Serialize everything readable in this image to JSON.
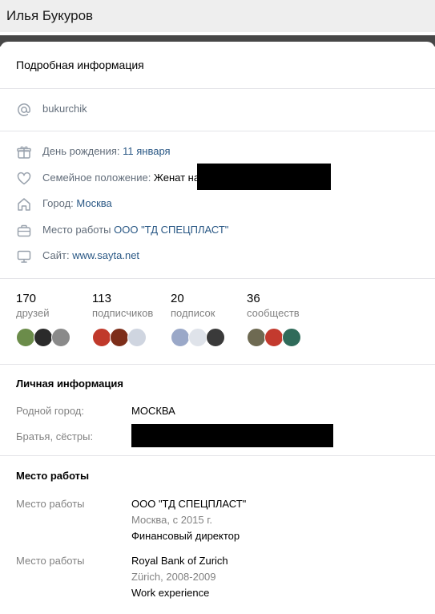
{
  "profile": {
    "name": "Илья Букуров"
  },
  "details": {
    "title": "Подробная информация",
    "username": "bukurchik",
    "birthday": {
      "label": "День рождения: ",
      "value": "11 января"
    },
    "family": {
      "label": "Семейное положение: ",
      "value": "Женат на"
    },
    "city": {
      "label": "Город: ",
      "value": "Москва"
    },
    "work": {
      "label": "Место работы ",
      "value": "ООО \"ТД СПЕЦПЛАСТ\""
    },
    "site": {
      "label": "Сайт: ",
      "value": "www.sayta.net"
    }
  },
  "counters": [
    {
      "count": "170",
      "label": "друзей",
      "avatars": [
        "#6b8c4a",
        "#2b2b2b",
        "#8a8a8a"
      ]
    },
    {
      "count": "113",
      "label": "подписчиков",
      "avatars": [
        "#c0392b",
        "#7d2e1a",
        "#cfd5e0"
      ]
    },
    {
      "count": "20",
      "label": "подписок",
      "avatars": [
        "#9aa8c8",
        "#dfe3ea",
        "#3a3a3a"
      ]
    },
    {
      "count": "36",
      "label": "сообществ",
      "avatars": [
        "#6e6a52",
        "#c33a2e",
        "#2f6b5a"
      ]
    }
  ],
  "personal": {
    "title": "Личная информация",
    "hometown_label": "Родной город:",
    "hometown_value": "МОСКВА",
    "siblings_label": "Братья, сёстры:"
  },
  "career": {
    "title": "Место работы",
    "items": [
      {
        "label": "Место работы",
        "company": "ООО \"ТД СПЕЦПЛАСТ\"",
        "period": "Москва, с 2015 г.",
        "position": "Финансовый директор"
      },
      {
        "label": "Место работы",
        "company": "Royal Bank of Zurich",
        "period": "Zürich, 2008-2009",
        "position": "Work experience"
      }
    ]
  },
  "colors": {
    "link": "#2a5885",
    "muted": "#828282",
    "icon": "#99a2ad"
  }
}
